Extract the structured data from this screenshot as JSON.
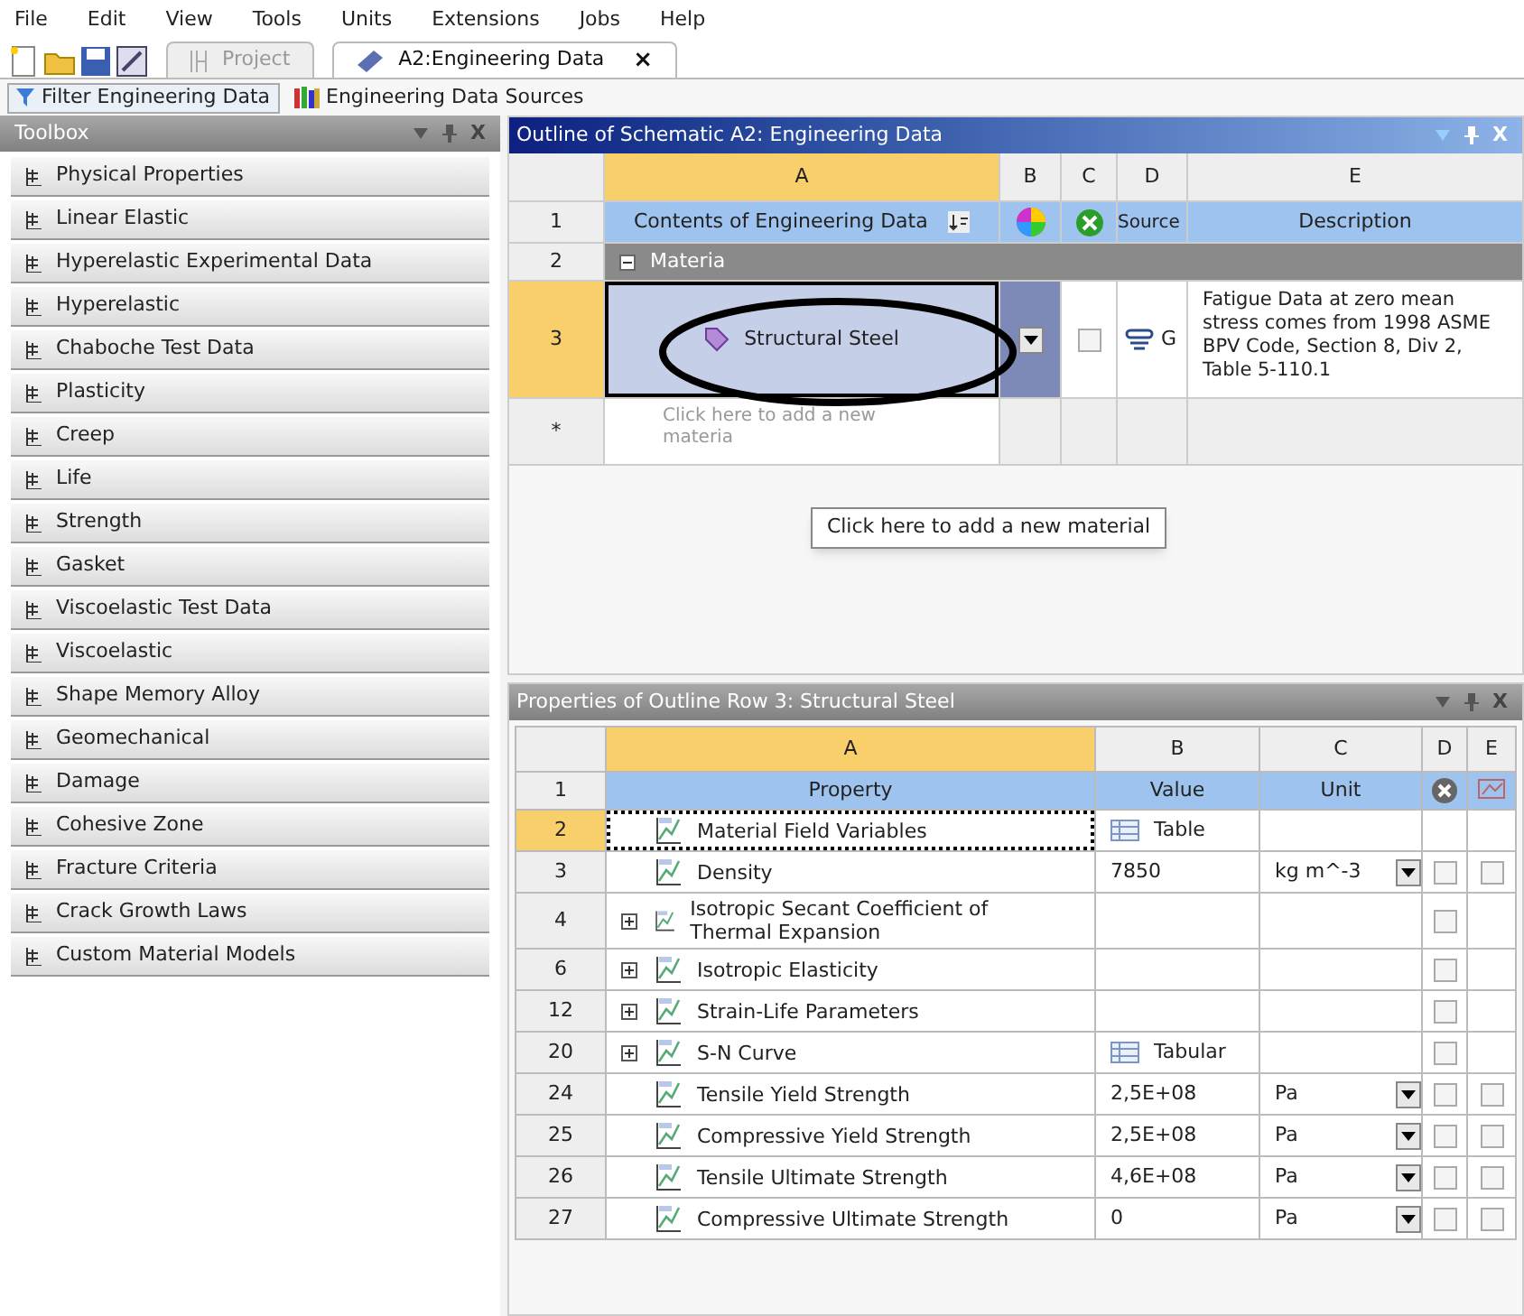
{
  "menu": [
    "File",
    "Edit",
    "View",
    "Tools",
    "Units",
    "Extensions",
    "Jobs",
    "Help"
  ],
  "tabs": [
    {
      "label": "Project",
      "selected": false
    },
    {
      "label": "A2:Engineering Data",
      "selected": true,
      "close": "×"
    }
  ],
  "filter_bar": {
    "filter": "Filter Engineering Data",
    "sources": "Engineering Data Sources"
  },
  "toolbox": {
    "title": "Toolbox",
    "close": "X",
    "items": [
      "Physical Properties",
      "Linear Elastic",
      "Hyperelastic Experimental Data",
      "Hyperelastic",
      "Chaboche Test Data",
      "Plasticity",
      "Creep",
      "Life",
      "Strength",
      "Gasket",
      "Viscoelastic Test Data",
      "Viscoelastic",
      "Shape Memory Alloy",
      "Geomechanical",
      "Damage",
      "Cohesive Zone",
      "Fracture Criteria",
      "Crack Growth Laws",
      "Custom Material Models"
    ]
  },
  "outline": {
    "title": "Outline of Schematic A2: Engineering Data",
    "close": "X",
    "columns": [
      "A",
      "B",
      "C",
      "D",
      "E"
    ],
    "header": {
      "num": "1",
      "contents": "Contents of Engineering Data",
      "source": "Source",
      "description": "Description"
    },
    "group": {
      "num": "2",
      "label": "Materia",
      "expanded": true
    },
    "rows": [
      {
        "num": "3",
        "name": "Structural Steel",
        "selected": true,
        "checked": false,
        "source": "G",
        "description": "Fatigue Data at zero mean stress comes from 1998 ASME BPV Code, Section 8, Div 2, Table 5-110.1"
      }
    ],
    "new_row": {
      "num": "*",
      "placeholder": "Click here to add a new materia"
    },
    "tooltip": "Click here to add a new material"
  },
  "properties": {
    "title": "Properties of Outline Row 3: Structural Steel",
    "close": "X",
    "columns": [
      "A",
      "B",
      "C",
      "D",
      "E"
    ],
    "header": {
      "num": "1",
      "property": "Property",
      "value": "Value",
      "unit": "Unit"
    },
    "rows": [
      {
        "num": "2",
        "name": "Material Field Variables",
        "selected": true,
        "value": "Table",
        "tabular": true
      },
      {
        "num": "3",
        "name": "Density",
        "selected": false,
        "value": "7850",
        "unit": "kg m^-3",
        "checkboxes": [
          {
            "checked": false
          },
          {
            "checked": false
          }
        ]
      },
      {
        "num": "4",
        "name": "Isotropic Secant Coefficient of Thermal Expansion",
        "selected": false,
        "expanded": false,
        "checkboxes": [
          {
            "checked": false
          }
        ]
      },
      {
        "num": "6",
        "name": "Isotropic Elasticity",
        "selected": false,
        "expanded": false,
        "checkboxes": [
          {
            "checked": false
          }
        ]
      },
      {
        "num": "12",
        "name": "Strain-Life Parameters",
        "selected": false,
        "expanded": false,
        "checkboxes": [
          {
            "checked": false
          }
        ]
      },
      {
        "num": "20",
        "name": "S-N Curve",
        "selected": false,
        "expanded": false,
        "value": "Tabular",
        "tabular": true,
        "checkboxes": [
          {
            "checked": false
          }
        ]
      },
      {
        "num": "24",
        "name": "Tensile Yield Strength",
        "selected": false,
        "value": "2,5E+08",
        "unit": "Pa",
        "checkboxes": [
          {
            "checked": false
          },
          {
            "checked": false
          }
        ]
      },
      {
        "num": "25",
        "name": "Compressive Yield Strength",
        "selected": false,
        "value": "2,5E+08",
        "unit": "Pa",
        "checkboxes": [
          {
            "checked": false
          },
          {
            "checked": false
          }
        ]
      },
      {
        "num": "26",
        "name": "Tensile Ultimate Strength",
        "selected": false,
        "value": "4,6E+08",
        "unit": "Pa",
        "checkboxes": [
          {
            "checked": false
          },
          {
            "checked": false
          }
        ]
      },
      {
        "num": "27",
        "name": "Compressive Ultimate Strength",
        "selected": false,
        "value": "0",
        "unit": "Pa",
        "checkboxes": [
          {
            "checked": false
          },
          {
            "checked": false
          }
        ]
      }
    ]
  }
}
